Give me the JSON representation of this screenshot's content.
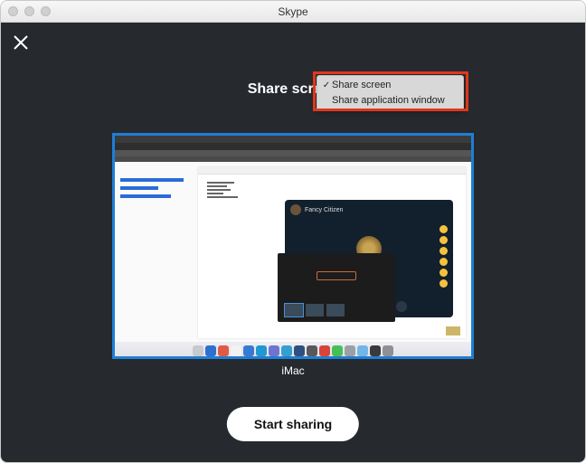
{
  "window": {
    "title": "Skype"
  },
  "heading": "Share screen",
  "dropdown": {
    "items": [
      {
        "label": "Share screen",
        "checked": true
      },
      {
        "label": "Share application window",
        "checked": false
      }
    ]
  },
  "preview": {
    "label": "iMac",
    "call_name": "Fancy Citizen"
  },
  "buttons": {
    "start_sharing": "Start sharing"
  },
  "dock_colors": [
    "#c9c9cc",
    "#2f6fd0",
    "#e05b43",
    "#f2f2f2",
    "#3879d4",
    "#2098d1",
    "#7074d1",
    "#33a0d0",
    "#2f4f7f",
    "#58595b",
    "#d8433c",
    "#46c056",
    "#9aa0a6",
    "#72b6e8",
    "#3a3a3c",
    "#8f9093"
  ]
}
